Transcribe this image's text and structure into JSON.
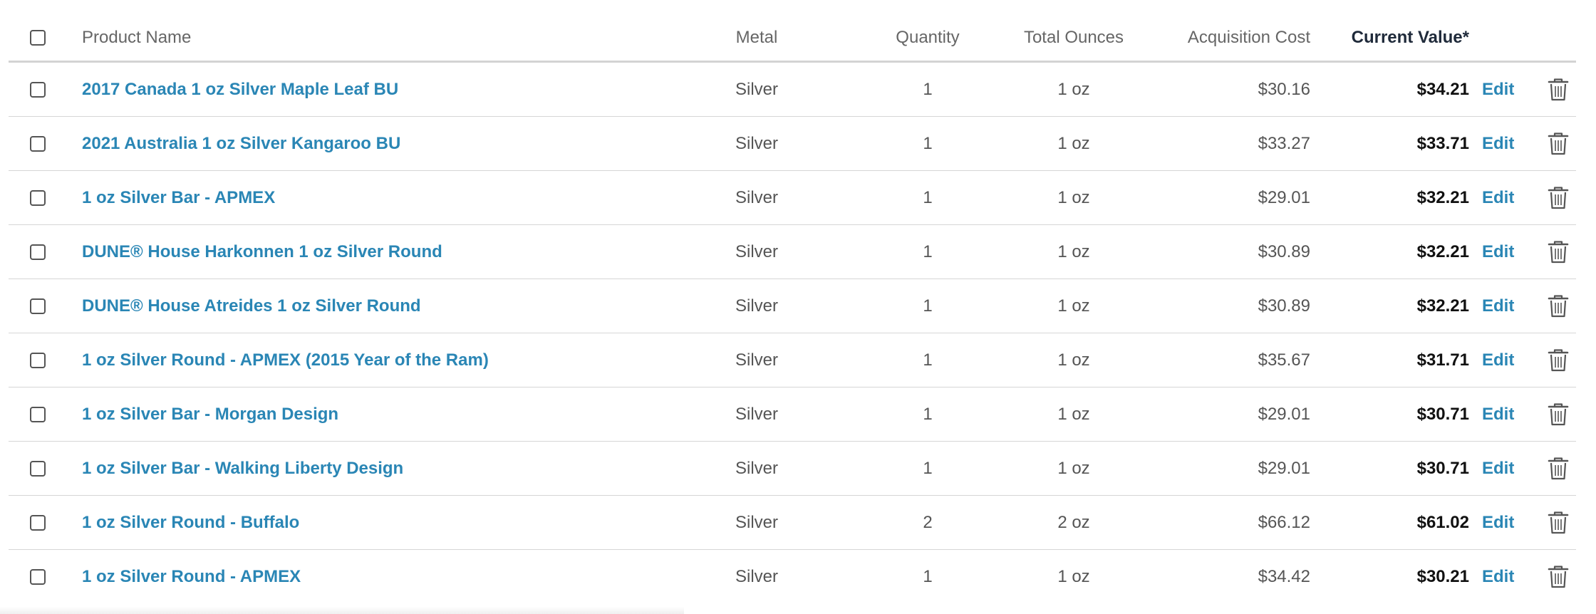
{
  "table": {
    "headers": {
      "product_name": "Product Name",
      "metal": "Metal",
      "quantity": "Quantity",
      "total_ounces": "Total Ounces",
      "acquisition_cost": "Acquisition Cost",
      "current_value": "Current Value*"
    },
    "edit_label": "Edit",
    "rows": [
      {
        "name": "2017 Canada 1 oz Silver Maple Leaf BU",
        "metal": "Silver",
        "quantity": "1",
        "ounces": "1 oz",
        "cost": "$30.16",
        "value": "$34.21"
      },
      {
        "name": "2021 Australia 1 oz Silver Kangaroo BU",
        "metal": "Silver",
        "quantity": "1",
        "ounces": "1 oz",
        "cost": "$33.27",
        "value": "$33.71"
      },
      {
        "name": "1 oz Silver Bar - APMEX",
        "metal": "Silver",
        "quantity": "1",
        "ounces": "1 oz",
        "cost": "$29.01",
        "value": "$32.21"
      },
      {
        "name": "DUNE® House Harkonnen 1 oz Silver Round",
        "metal": "Silver",
        "quantity": "1",
        "ounces": "1 oz",
        "cost": "$30.89",
        "value": "$32.21"
      },
      {
        "name": "DUNE® House Atreides 1 oz Silver Round",
        "metal": "Silver",
        "quantity": "1",
        "ounces": "1 oz",
        "cost": "$30.89",
        "value": "$32.21"
      },
      {
        "name": "1 oz Silver Round - APMEX (2015 Year of the Ram)",
        "metal": "Silver",
        "quantity": "1",
        "ounces": "1 oz",
        "cost": "$35.67",
        "value": "$31.71"
      },
      {
        "name": "1 oz Silver Bar - Morgan Design",
        "metal": "Silver",
        "quantity": "1",
        "ounces": "1 oz",
        "cost": "$29.01",
        "value": "$30.71"
      },
      {
        "name": "1 oz Silver Bar - Walking Liberty Design",
        "metal": "Silver",
        "quantity": "1",
        "ounces": "1 oz",
        "cost": "$29.01",
        "value": "$30.71"
      },
      {
        "name": "1 oz Silver Round - Buffalo",
        "metal": "Silver",
        "quantity": "2",
        "ounces": "2 oz",
        "cost": "$66.12",
        "value": "$61.02"
      },
      {
        "name": "1 oz Silver Round - APMEX",
        "metal": "Silver",
        "quantity": "1",
        "ounces": "1 oz",
        "cost": "$34.42",
        "value": "$30.21"
      }
    ]
  },
  "icons": {
    "delete": "trash-icon",
    "select": "checkbox"
  },
  "colors": {
    "link": "#2a86b5",
    "value": "#111111",
    "header": "#666666",
    "divider": "#d6d6d6"
  }
}
